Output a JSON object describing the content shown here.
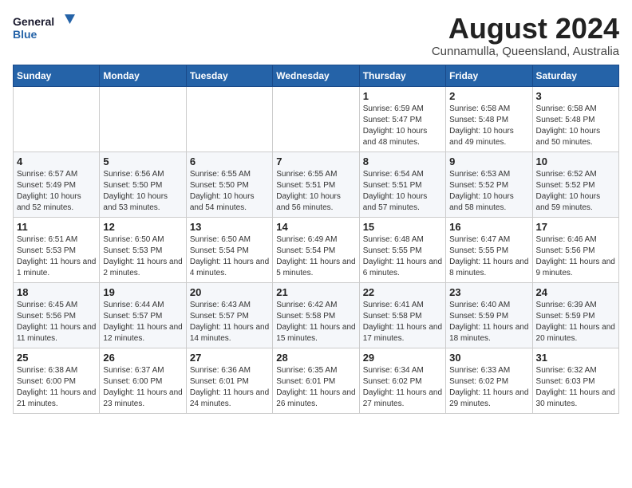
{
  "header": {
    "logo_general": "General",
    "logo_blue": "Blue",
    "month_year": "August 2024",
    "location": "Cunnamulla, Queensland, Australia"
  },
  "weekdays": [
    "Sunday",
    "Monday",
    "Tuesday",
    "Wednesday",
    "Thursday",
    "Friday",
    "Saturday"
  ],
  "weeks": [
    [
      {
        "day": "",
        "info": ""
      },
      {
        "day": "",
        "info": ""
      },
      {
        "day": "",
        "info": ""
      },
      {
        "day": "",
        "info": ""
      },
      {
        "day": "1",
        "info": "Sunrise: 6:59 AM\nSunset: 5:47 PM\nDaylight: 10 hours and 48 minutes."
      },
      {
        "day": "2",
        "info": "Sunrise: 6:58 AM\nSunset: 5:48 PM\nDaylight: 10 hours and 49 minutes."
      },
      {
        "day": "3",
        "info": "Sunrise: 6:58 AM\nSunset: 5:48 PM\nDaylight: 10 hours and 50 minutes."
      }
    ],
    [
      {
        "day": "4",
        "info": "Sunrise: 6:57 AM\nSunset: 5:49 PM\nDaylight: 10 hours and 52 minutes."
      },
      {
        "day": "5",
        "info": "Sunrise: 6:56 AM\nSunset: 5:50 PM\nDaylight: 10 hours and 53 minutes."
      },
      {
        "day": "6",
        "info": "Sunrise: 6:55 AM\nSunset: 5:50 PM\nDaylight: 10 hours and 54 minutes."
      },
      {
        "day": "7",
        "info": "Sunrise: 6:55 AM\nSunset: 5:51 PM\nDaylight: 10 hours and 56 minutes."
      },
      {
        "day": "8",
        "info": "Sunrise: 6:54 AM\nSunset: 5:51 PM\nDaylight: 10 hours and 57 minutes."
      },
      {
        "day": "9",
        "info": "Sunrise: 6:53 AM\nSunset: 5:52 PM\nDaylight: 10 hours and 58 minutes."
      },
      {
        "day": "10",
        "info": "Sunrise: 6:52 AM\nSunset: 5:52 PM\nDaylight: 10 hours and 59 minutes."
      }
    ],
    [
      {
        "day": "11",
        "info": "Sunrise: 6:51 AM\nSunset: 5:53 PM\nDaylight: 11 hours and 1 minute."
      },
      {
        "day": "12",
        "info": "Sunrise: 6:50 AM\nSunset: 5:53 PM\nDaylight: 11 hours and 2 minutes."
      },
      {
        "day": "13",
        "info": "Sunrise: 6:50 AM\nSunset: 5:54 PM\nDaylight: 11 hours and 4 minutes."
      },
      {
        "day": "14",
        "info": "Sunrise: 6:49 AM\nSunset: 5:54 PM\nDaylight: 11 hours and 5 minutes."
      },
      {
        "day": "15",
        "info": "Sunrise: 6:48 AM\nSunset: 5:55 PM\nDaylight: 11 hours and 6 minutes."
      },
      {
        "day": "16",
        "info": "Sunrise: 6:47 AM\nSunset: 5:55 PM\nDaylight: 11 hours and 8 minutes."
      },
      {
        "day": "17",
        "info": "Sunrise: 6:46 AM\nSunset: 5:56 PM\nDaylight: 11 hours and 9 minutes."
      }
    ],
    [
      {
        "day": "18",
        "info": "Sunrise: 6:45 AM\nSunset: 5:56 PM\nDaylight: 11 hours and 11 minutes."
      },
      {
        "day": "19",
        "info": "Sunrise: 6:44 AM\nSunset: 5:57 PM\nDaylight: 11 hours and 12 minutes."
      },
      {
        "day": "20",
        "info": "Sunrise: 6:43 AM\nSunset: 5:57 PM\nDaylight: 11 hours and 14 minutes."
      },
      {
        "day": "21",
        "info": "Sunrise: 6:42 AM\nSunset: 5:58 PM\nDaylight: 11 hours and 15 minutes."
      },
      {
        "day": "22",
        "info": "Sunrise: 6:41 AM\nSunset: 5:58 PM\nDaylight: 11 hours and 17 minutes."
      },
      {
        "day": "23",
        "info": "Sunrise: 6:40 AM\nSunset: 5:59 PM\nDaylight: 11 hours and 18 minutes."
      },
      {
        "day": "24",
        "info": "Sunrise: 6:39 AM\nSunset: 5:59 PM\nDaylight: 11 hours and 20 minutes."
      }
    ],
    [
      {
        "day": "25",
        "info": "Sunrise: 6:38 AM\nSunset: 6:00 PM\nDaylight: 11 hours and 21 minutes."
      },
      {
        "day": "26",
        "info": "Sunrise: 6:37 AM\nSunset: 6:00 PM\nDaylight: 11 hours and 23 minutes."
      },
      {
        "day": "27",
        "info": "Sunrise: 6:36 AM\nSunset: 6:01 PM\nDaylight: 11 hours and 24 minutes."
      },
      {
        "day": "28",
        "info": "Sunrise: 6:35 AM\nSunset: 6:01 PM\nDaylight: 11 hours and 26 minutes."
      },
      {
        "day": "29",
        "info": "Sunrise: 6:34 AM\nSunset: 6:02 PM\nDaylight: 11 hours and 27 minutes."
      },
      {
        "day": "30",
        "info": "Sunrise: 6:33 AM\nSunset: 6:02 PM\nDaylight: 11 hours and 29 minutes."
      },
      {
        "day": "31",
        "info": "Sunrise: 6:32 AM\nSunset: 6:03 PM\nDaylight: 11 hours and 30 minutes."
      }
    ]
  ]
}
